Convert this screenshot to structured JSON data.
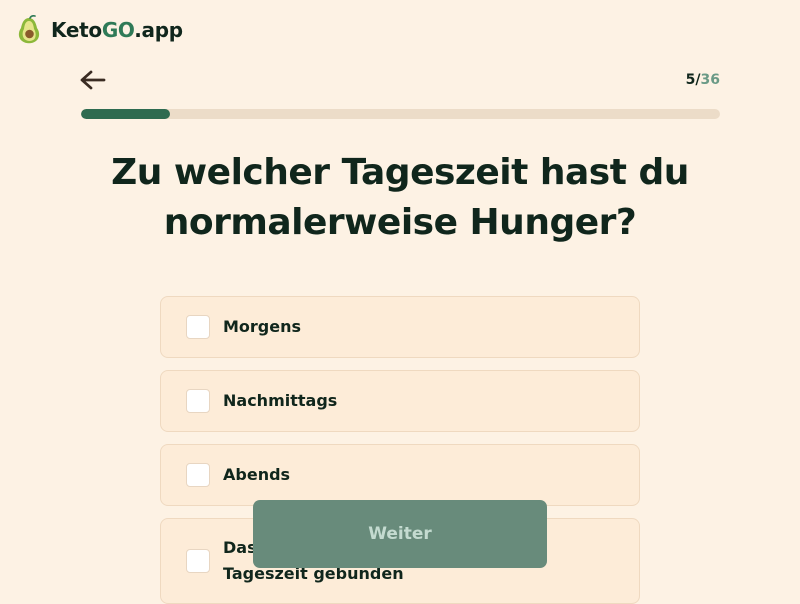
{
  "header": {
    "logo_name": "Keto",
    "logo_go": "GO",
    "logo_domain": ".app",
    "logo_icon": "avocado-icon",
    "back_icon": "arrow-left-icon",
    "step_current": "5",
    "step_separator": "/",
    "step_total": "36",
    "progress_fraction": 0.139
  },
  "question": {
    "line1": "Zu welcher Tageszeit hast du",
    "line2": "normalerweise Hunger?"
  },
  "options": [
    {
      "label": "Morgens",
      "checked": false
    },
    {
      "label": "Nachmittags",
      "checked": false
    },
    {
      "label": "Abends",
      "checked": false
    },
    {
      "label": "Das ist bei mir an keine bestimmte Tageszeit gebunden",
      "checked": false
    }
  ],
  "next_button": {
    "label": "Weiter",
    "enabled": false
  },
  "colors": {
    "background": "#fdf2e4",
    "accent": "#2e6b50",
    "button": "#688b7b",
    "text": "#10261c"
  }
}
